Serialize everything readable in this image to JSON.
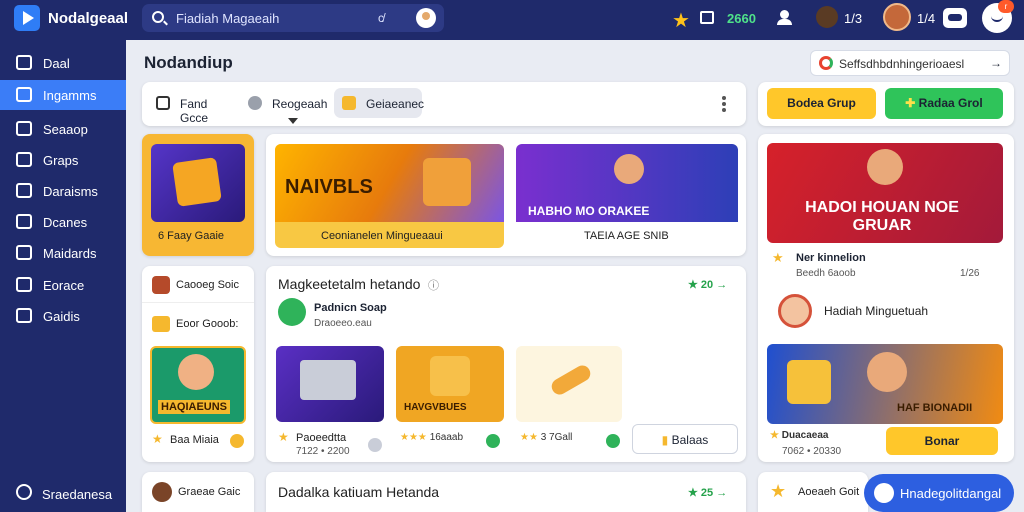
{
  "topbar": {
    "brand": "Nodalgeaal",
    "search_placeholder": "Fiadiah Magaeaih",
    "filter_label": "c̸",
    "coins": "2660",
    "count1": "1/3",
    "count2": "1/4",
    "badge": "r"
  },
  "sidebar": {
    "items": [
      {
        "label": "Daal",
        "icon": "home-icon"
      },
      {
        "label": "Ingamms",
        "icon": "chart-icon"
      },
      {
        "label": "Seaaop",
        "icon": "shop-icon"
      },
      {
        "label": "Graps",
        "icon": "groups-icon"
      },
      {
        "label": "Daraisms",
        "icon": "calendar-icon"
      },
      {
        "label": "Dcanes",
        "icon": "list-icon"
      },
      {
        "label": "Maidards",
        "icon": "trend-icon"
      },
      {
        "label": "Eorace",
        "icon": "upload-icon"
      },
      {
        "label": "Gaidis",
        "icon": "puzzle-icon"
      }
    ],
    "bottom_label": "Sraedanesa"
  },
  "page": {
    "title": "Nodandiup",
    "lang_pill": "Seffsdhbdnhingerioaesl",
    "tabs": [
      "Fand Gcce",
      "Reogeaah",
      "Geiaeanec"
    ],
    "btn_yellow": "Bodea Grup",
    "btn_green": "Radaa Grol"
  },
  "featured": {
    "side_label": "6 Faay Gaaie",
    "banner1_text": "NAIVBLS",
    "banner1_caption": "Ceonianelen Mingueaaui",
    "banner2_text": "HABHO MO ORAKEE",
    "banner2_caption": "TAEIA AGE SNIB",
    "right_banner_text": "HADOI HOUAN NOE GRUAR",
    "right_title": "Ner kinnelion",
    "right_sub": "Beedh 6aoob",
    "right_count": "1/26",
    "right_user": "Hadiah Minguetuah"
  },
  "left_panel": {
    "top_label": "Caooeg Soic",
    "sub_label": "Eoor Gooob:",
    "game_text": "HAQIAEUNS",
    "game_rating_label": "Baa Miaia",
    "bottom_label": "Graeae Gaic"
  },
  "market": {
    "title": "Magkeetetalm hetando",
    "stat": "20",
    "seller_name": "Padnicn Soap",
    "seller_sub": "Draoeeo.eau",
    "items": [
      {
        "title": "Paoeedtta",
        "price": "7122 • 2200"
      },
      {
        "title": "16aaab",
        "price": ""
      },
      {
        "title": "3 7Gall",
        "price": ""
      }
    ],
    "btn_label": "Balaas",
    "item2_text": "HAVGVBUES"
  },
  "right_lower": {
    "game_text": "HAF BIONADII",
    "rating_line": "Duacaeaa",
    "price_line": "7062 • 20330",
    "btn_label": "Bonar"
  },
  "bottom": {
    "title": "Dadalka katiuam Hetanda",
    "stat": "25",
    "right_label": "Aoeaeh Goit",
    "chat_label": "Hnadegolitdangal"
  },
  "colors": {
    "nav": "#1f2a6b",
    "accent_blue": "#3b7df7",
    "accent_yellow": "#ffc72a",
    "accent_green": "#2fc45a"
  }
}
